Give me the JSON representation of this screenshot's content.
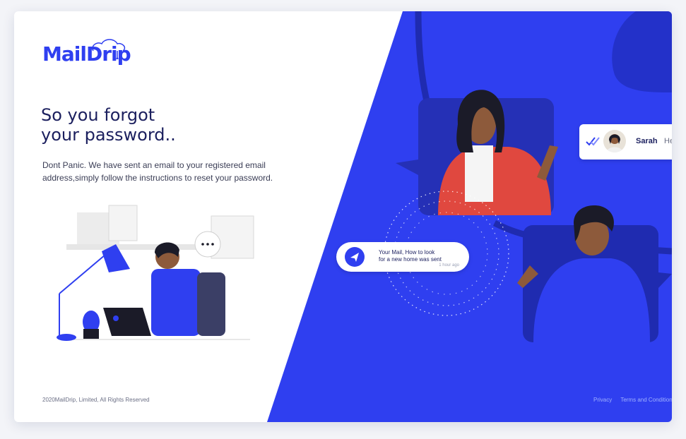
{
  "brand": {
    "name": "MailDrip",
    "accent": "#2f3ff0",
    "dark_text": "#1b1f5e"
  },
  "heading": {
    "line1": "So you forgot",
    "line2": "your password.."
  },
  "description": "Dont Panic. We have sent an email to your registered email address,simply follow the instructions to reset your password.",
  "notification": {
    "icon": "paper-plane-icon",
    "text_line1": "Your Mail, How to look",
    "text_line2": "for a new home was sent",
    "time": "1 hour ago"
  },
  "chat_preview": {
    "check_icon": "double-check-icon",
    "name": "Sarah",
    "message": "He"
  },
  "footer": {
    "copyright": "2020MailDrip, Limited, All  Rights Reserved",
    "privacy": "Privacy",
    "terms": "Terms and Condition"
  }
}
